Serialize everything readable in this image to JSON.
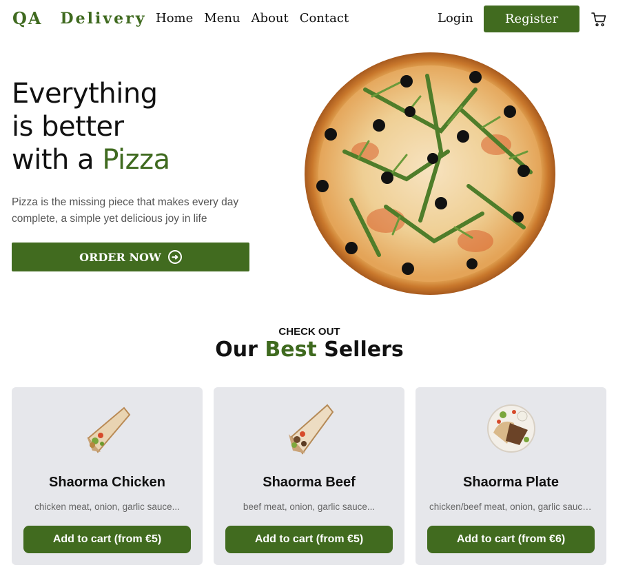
{
  "header": {
    "logo": {
      "qa": "QA",
      "word": "Delivery"
    },
    "nav": [
      "Home",
      "Menu",
      "About",
      "Contact"
    ],
    "login_label": "Login",
    "register_label": "Register",
    "cart_icon": "cart-icon"
  },
  "hero": {
    "title_line1": "Everything",
    "title_line2": "is better",
    "title_line3_prefix": "with a ",
    "title_line3_accent": "Pizza",
    "description": "Pizza is the missing piece that makes every day complete, a simple yet delicious joy in life",
    "order_label": "ORDER NOW",
    "order_icon": "arrow-right-circle-icon",
    "image": "pizza-image"
  },
  "bestsellers": {
    "eyebrow": "CHECK OUT",
    "title_prefix": "Our ",
    "title_accent": "Best",
    "title_suffix": " Sellers",
    "items": [
      {
        "name": "Shaorma Chicken",
        "description": "chicken meat, onion, garlic sauce...",
        "button": "Add to cart (from €5)",
        "image": "shaorma-chicken-image"
      },
      {
        "name": "Shaorma Beef",
        "description": "beef meat, onion, garlic sauce...",
        "button": "Add to cart (from €5)",
        "image": "shaorma-beef-image"
      },
      {
        "name": "Shaorma Plate",
        "description": "chicken/beef meat, onion, garlic sauce...",
        "button": "Add to cart (from €6)",
        "image": "shaorma-plate-image"
      }
    ]
  },
  "colors": {
    "accent": "#416b1f",
    "card_bg": "#e6e7eb",
    "text_muted": "#666666"
  }
}
